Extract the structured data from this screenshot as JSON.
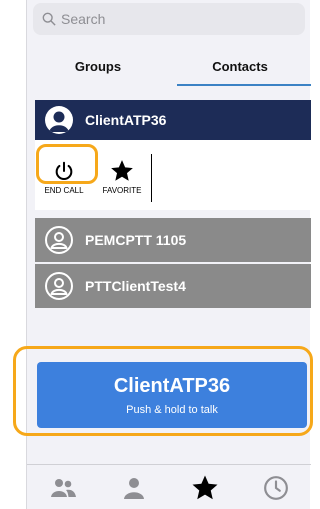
{
  "search": {
    "placeholder": "Search"
  },
  "tabs": [
    {
      "label": "Groups",
      "active": false
    },
    {
      "label": "Contacts",
      "active": true
    }
  ],
  "contacts": [
    {
      "name": "ClientATP36",
      "state": "selected"
    },
    {
      "name": "PEMCPTT 1105",
      "state": "inactive"
    },
    {
      "name": "PTTClientTest4",
      "state": "inactive"
    }
  ],
  "actions": {
    "end_call": {
      "label": "END CALL",
      "icon": "power-icon"
    },
    "favorite": {
      "label": "FAVORITE",
      "icon": "star-icon"
    }
  },
  "ptt": {
    "name": "ClientATP36",
    "hint": "Push & hold to talk"
  },
  "bottom_nav": [
    {
      "icon": "group-icon"
    },
    {
      "icon": "person-icon"
    },
    {
      "icon": "star-icon",
      "active": true
    },
    {
      "icon": "clock-icon"
    }
  ],
  "colors": {
    "selected_row": "#1d2c57",
    "inactive_row": "#8a8a8a",
    "ptt_button": "#3d80dd",
    "highlight": "#f6a81a",
    "tab_underline": "#3b82c4"
  }
}
